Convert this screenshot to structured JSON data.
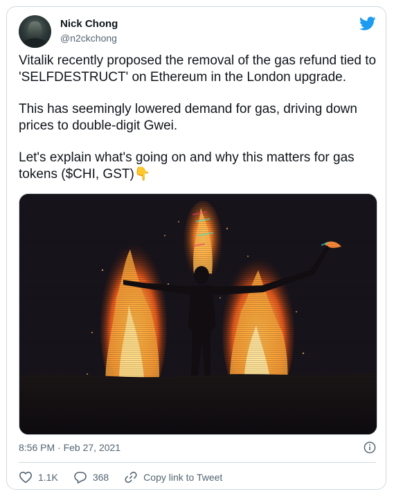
{
  "author": {
    "name": "Nick Chong",
    "handle": "@n2ckchong"
  },
  "tweet": {
    "paragraphs": [
      "Vitalik recently proposed the removal of the gas refund tied to 'SELFDESTRUCT' on Ethereum in the London upgrade.",
      "This has seemingly lowered demand for gas, driving down prices to double-digit Gwei.",
      "Let's explain what's going on and why this matters for gas tokens ($CHI, GST)👇"
    ],
    "timestamp": "8:56 PM · Feb 27, 2021"
  },
  "actions": {
    "likes": "1.1K",
    "replies": "368",
    "copy_link": "Copy link to Tweet"
  },
  "icons": {
    "brand": "twitter-bird-icon",
    "info": "info-icon",
    "like": "heart-icon",
    "reply": "reply-icon",
    "link": "link-icon"
  },
  "colors": {
    "twitter_blue": "#1d9bf0",
    "secondary_text": "#536471",
    "border": "#cfd9de"
  }
}
